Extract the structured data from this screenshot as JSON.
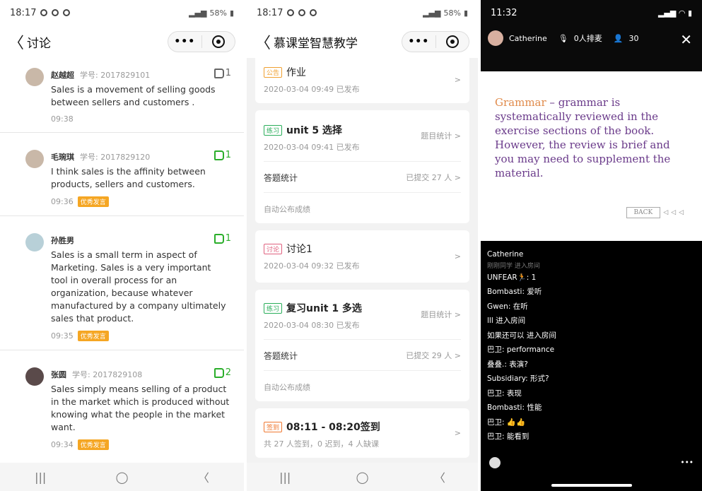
{
  "panel1": {
    "status": {
      "time": "18:17",
      "battery": "58%"
    },
    "nav": {
      "back": "〈",
      "title": "讨论"
    },
    "posts": [
      {
        "name": "赵越超",
        "sid_label": "学号:",
        "sid": "2017829101",
        "likes": "1",
        "text": "Sales is a movement of selling goods between sellers and customers .",
        "time": "09:38",
        "badge": ""
      },
      {
        "name": "毛琬琪",
        "sid_label": "学号:",
        "sid": "2017829120",
        "likes": "1",
        "text": "I think sales is the affinity between products, sellers and customers.",
        "time": "09:36",
        "badge": "优秀发言"
      },
      {
        "name": "孙胜男",
        "sid_label": "",
        "sid": "",
        "likes": "1",
        "text": "Sales is a small term in aspect of Marketing. Sales is a very important tool in overall process for an organization, because whatever manufactured by a company ultimately sales that product.",
        "time": "09:35",
        "badge": "优秀发言"
      },
      {
        "name": "张圆",
        "sid_label": "学号:",
        "sid": "2017829108",
        "likes": "2",
        "text": "Sales simply means selling of a product in the market which is produced without knowing what the people in the market want.",
        "time": "09:34",
        "badge": "优秀发言"
      }
    ]
  },
  "panel2": {
    "status": {
      "time": "18:17",
      "battery": "58%"
    },
    "nav": {
      "back": "〈",
      "title": "慕课堂智慧教学"
    },
    "cards": {
      "c1": {
        "tag": "公告",
        "title": "作业",
        "date": "2020-03-04 09:49 已发布"
      },
      "c2": {
        "tag": "练习",
        "title": "unit 5 选择",
        "date": "2020-03-04 09:41 已发布",
        "right": "题目统计 >",
        "stat": "答题统计",
        "stat_right": "已提交 27 人 >",
        "auto": "自动公布成绩"
      },
      "c3": {
        "tag": "讨论",
        "title": "讨论1",
        "date": "2020-03-04 09:32 已发布"
      },
      "c4": {
        "tag": "练习",
        "title": "复习unit 1 多选",
        "date": "2020-03-04 08:30 已发布",
        "right": "题目统计 >",
        "stat": "答题统计",
        "stat_right": "已提交 29 人 >",
        "auto": "自动公布成绩"
      },
      "c5": {
        "tag": "签到",
        "title": "08:11 - 08:20签到",
        "date": "共 27 人签到，0 迟到，4 人缺课"
      }
    }
  },
  "panel3": {
    "status": {
      "time": "11:32"
    },
    "user": {
      "name": "Catherine",
      "mic": "0人排麦",
      "count": "30"
    },
    "slide": {
      "gram": "Grammar",
      "text": "grammar is systematically reviewed in the exercise sections of the book. However, the review is brief and you may need to supplement the material.",
      "back": "BACK"
    },
    "chat": {
      "header": "Catherine",
      "faded": "刚刚同学 进入房间",
      "lines": [
        "UNFEAR🏃: 1",
        "Bombasti: 爱听",
        "Gwen: 在听",
        "lll 进入房间",
        "如果还可以 进入房间",
        "巴卫: performance",
        "叠叠.: 表演?",
        "Subsidiary: 形式?",
        "巴卫: 表现",
        "Bombasti:   性能",
        "巴卫: 👍👍",
        "巴卫: 能看到"
      ],
      "more": "•••"
    }
  },
  "softnav": {
    "recent": "|||",
    "home": "◯",
    "back": "〈"
  }
}
